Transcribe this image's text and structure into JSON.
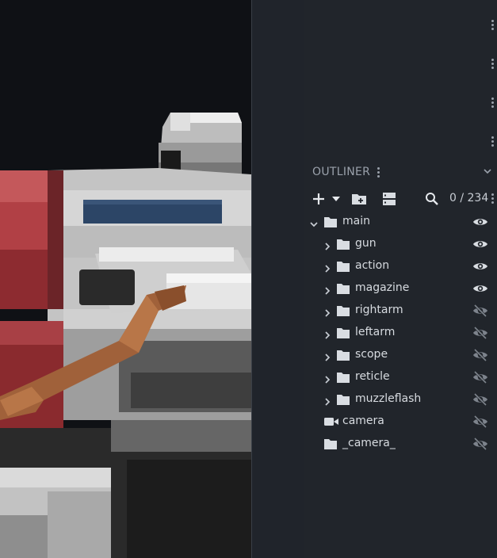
{
  "outliner": {
    "title": "OUTLINER",
    "counter": "0 / 234",
    "items": [
      {
        "label": "main",
        "icon": "folder-icon",
        "expander": "chevron-down-icon",
        "visibility": "eye-icon"
      },
      {
        "label": "gun",
        "icon": "folder-icon",
        "expander": "chevron-right-icon",
        "visibility": "eye-icon"
      },
      {
        "label": "action",
        "icon": "folder-icon",
        "expander": "chevron-right-icon",
        "visibility": "eye-icon"
      },
      {
        "label": "magazine",
        "icon": "folder-icon",
        "expander": "chevron-right-icon",
        "visibility": "eye-icon"
      },
      {
        "label": "rightarm",
        "icon": "folder-icon",
        "expander": "chevron-right-icon",
        "visibility": "eye-off-icon"
      },
      {
        "label": "leftarm",
        "icon": "folder-icon",
        "expander": "chevron-right-icon",
        "visibility": "eye-off-icon"
      },
      {
        "label": "scope",
        "icon": "folder-icon",
        "expander": "chevron-right-icon",
        "visibility": "eye-off-icon"
      },
      {
        "label": "reticle",
        "icon": "folder-icon",
        "expander": "chevron-right-icon",
        "visibility": "eye-off-icon"
      },
      {
        "label": "muzzleflash",
        "icon": "folder-icon",
        "expander": "chevron-right-icon",
        "visibility": "eye-off-icon"
      },
      {
        "label": "camera",
        "icon": "video-camera-icon",
        "expander": "",
        "visibility": "eye-off-icon"
      },
      {
        "label": "_camera_",
        "icon": "folder-icon",
        "expander": "",
        "visibility": "eye-off-icon"
      }
    ]
  },
  "toolbar": {
    "buttons": [
      "add-icon",
      "dropdown-caret-icon",
      "new-folder-icon",
      "server-icon",
      "search-icon",
      "more-icon"
    ]
  },
  "colors": {
    "viewport_bg": "#0f1115",
    "panel_bg": "#21252b",
    "text": "#d7dbe0",
    "muted": "#9aa1ab",
    "model_red": "#a0363a",
    "model_grey": "#c8c8c8",
    "model_blue": "#2c4566",
    "model_brown": "#a0613a"
  }
}
